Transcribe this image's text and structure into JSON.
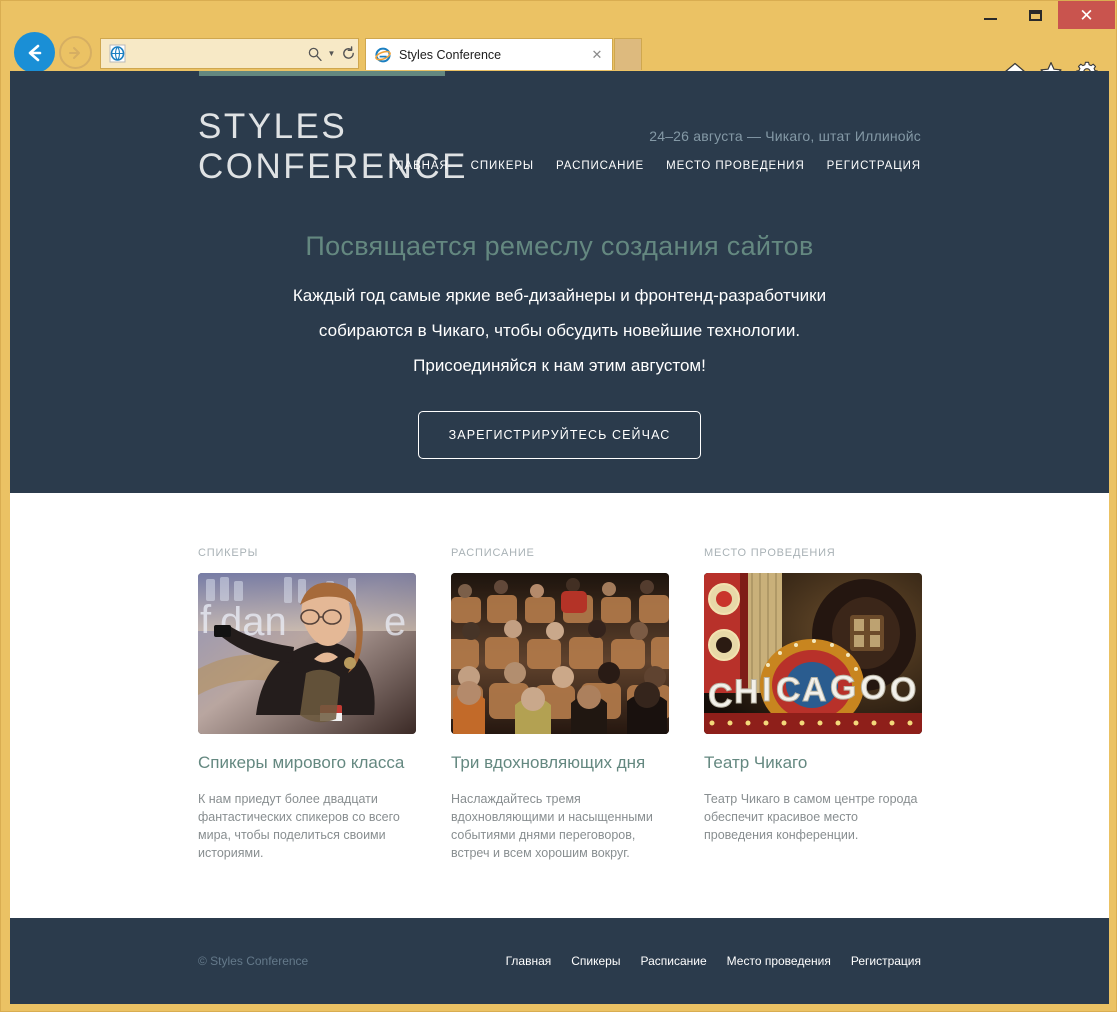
{
  "browser": {
    "window_controls": {
      "minimize": "—",
      "maximize": "□",
      "close": "✕"
    },
    "back_icon": "back-arrow-icon",
    "forward_icon": "forward-arrow-icon",
    "address_value": "",
    "address_placeholder": "",
    "search_icon": "search-icon",
    "dropdown_icon": "chevron-down-icon",
    "refresh_icon": "refresh-icon",
    "page_icon": "page-icon",
    "tab": {
      "title": "Styles Conference",
      "favicon": "internet-explorer-icon",
      "close": "✕"
    },
    "toolbar": {
      "home": "home-icon",
      "favorites": "star-icon",
      "settings": "gear-icon"
    }
  },
  "page": {
    "progress_percent": 22,
    "logo": "STYLES\nCONFERENCE",
    "logo_line1": "STYLES",
    "logo_line2": "CONFERENCE",
    "tagline": "24–26 августа — Чикаго, штат Иллинойс",
    "nav": [
      {
        "label": "ГЛАВНАЯ"
      },
      {
        "label": "СПИКЕРЫ"
      },
      {
        "label": "РАСПИСАНИЕ"
      },
      {
        "label": "МЕСТО ПРОВЕДЕНИЯ"
      },
      {
        "label": "РЕГИСТРАЦИЯ"
      }
    ],
    "hero": {
      "heading": "Посвящается ремеслу создания сайтов",
      "line1": "Каждый год самые яркие веб-дизайнеры и фронтенд-разработчики",
      "line2": "собираются в Чикаго, чтобы обсудить новейшие технологии.",
      "line3": "Присоединяйся к нам этим августом!",
      "cta": "ЗАРЕГИСТРИРУЙТЕСЬ СЕЙЧАС"
    },
    "teasers": [
      {
        "label": "СПИКЕРЫ",
        "image": "speaker-presenting-photo",
        "title": "Спикеры мирового класса",
        "text": "К нам приедут более двадцати фантастических спикеров со всего мира, чтобы поделиться своими историями."
      },
      {
        "label": "РАСПИСАНИЕ",
        "image": "conference-audience-photo",
        "title": "Три вдохновляющих дня",
        "text": "Наслаждайтесь тремя вдохновляющими и насыщенными событиями днями переговоров, встреч и всем хорошим вокруг."
      },
      {
        "label": "МЕСТО ПРОВЕДЕНИЯ",
        "image": "chicago-theatre-marquee-photo",
        "title": "Театр Чикаго",
        "text": "Театр Чикаго в самом центре города обеспечит красивое место проведения конференции."
      }
    ],
    "footer": {
      "copyright": "© Styles Conference",
      "nav": [
        {
          "label": "Главная"
        },
        {
          "label": "Спикеры"
        },
        {
          "label": "Расписание"
        },
        {
          "label": "Место проведения"
        },
        {
          "label": "Регистрация"
        }
      ]
    }
  },
  "colors": {
    "chrome": "#ebc264",
    "hero_bg": "#2b3b4c",
    "accent_teal": "#648880",
    "close_red": "#c9544e",
    "back_blue": "#1a8fd6"
  }
}
